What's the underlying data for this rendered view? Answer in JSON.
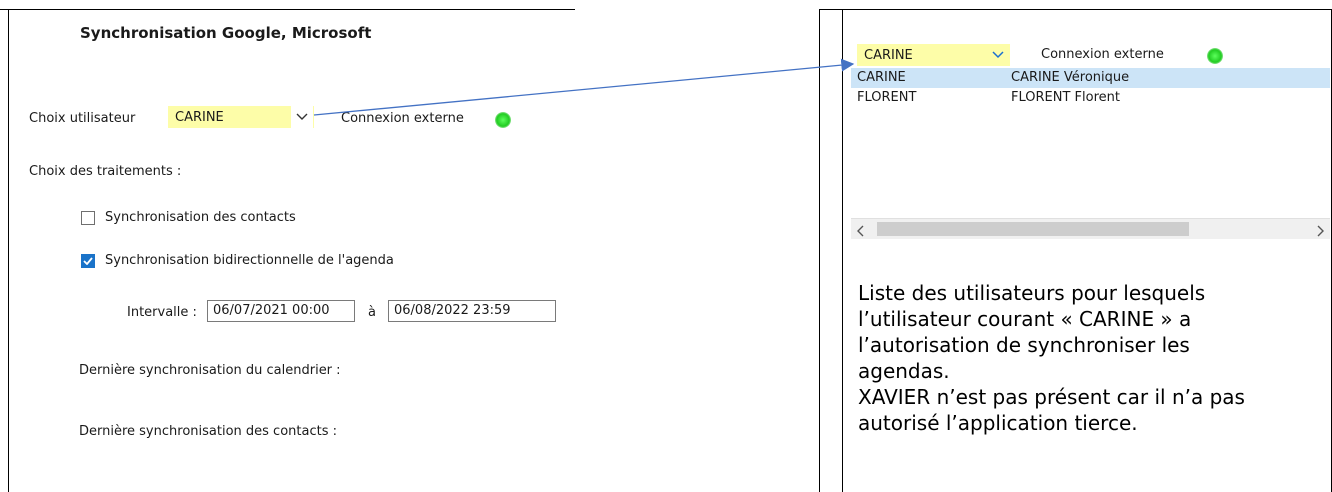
{
  "left": {
    "title": "Synchronisation Google, Microsoft",
    "user_label": "Choix utilisateur",
    "user_value": "CARINE",
    "connexion_label": "Connexion externe",
    "treatments_label": "Choix des traitements :",
    "sync_contacts": {
      "label": "Synchronisation des contacts",
      "checked": false
    },
    "sync_agenda": {
      "label": "Synchronisation bidirectionnelle de l'agenda",
      "checked": true
    },
    "interval_label": "Intervalle :",
    "interval_from": "06/07/2021 00:00",
    "interval_sep": "à",
    "interval_to": "06/08/2022 23:59",
    "last_calendar_label": "Dernière synchronisation du calendrier :",
    "last_contacts_label": "Dernière synchronisation des contacts :"
  },
  "right": {
    "combo_value": "CARINE",
    "connexion_label": "Connexion externe",
    "users": [
      {
        "code": "CARINE",
        "name": "CARINE Véronique",
        "selected": true
      },
      {
        "code": "FLORENT",
        "name": "FLORENT Florent",
        "selected": false
      }
    ],
    "description_lines": [
      "Liste des utilisateurs pour lesquels",
      "l’utilisateur courant « CARINE » a",
      "l’autorisation de synchroniser les",
      "agendas.",
      "XAVIER n’est pas présent car il n’a pas",
      "autorisé l’application tierce."
    ]
  },
  "colors": {
    "combo_bg": "#fdfda8",
    "status_green": "#22cc22",
    "checkbox_blue": "#1a73c9",
    "selection": "#cce4f7",
    "arrow": "#4472c4"
  }
}
